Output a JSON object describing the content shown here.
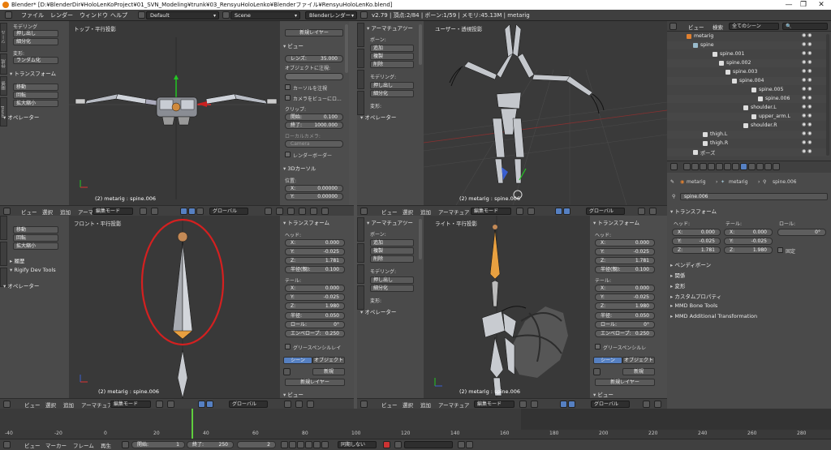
{
  "titlebar": {
    "text": "Blender* [D:¥BlenderDir¥HoloLenKoProject¥01_SVN_Modeling¥trunk¥03_RensyuHoloLenko¥Blenderファイル¥RensyuHoloLenKo.blend]"
  },
  "infobar": {
    "menus": [
      "ファイル",
      "レンダー",
      "ウィンドウ",
      "ヘルプ"
    ],
    "layout": "Default",
    "scene": "Scene",
    "engine": "Blenderレンダー",
    "stats": "v2.79 | 頂点:2/84 | ボーン:1/59 | メモリ:45.13M | metarig"
  },
  "tl_shelf": {
    "modeling_head": "モデリング",
    "btn1": "押し出し",
    "btn2": "細分化",
    "deform_head": "変形:",
    "deform_btn": "ランダム化",
    "transform_head": "トランスフォーム",
    "t1": "移動",
    "t2": "回転",
    "t3": "拡大縮小",
    "operator_head": "オペレーター",
    "tabs": [
      "ツール",
      "作成",
      "関係",
      "mmd"
    ]
  },
  "tl_view": {
    "title": "トップ・平行投影",
    "status": "(2) metarig : spine.006"
  },
  "tl_props": {
    "new_layer": "新規レイヤー",
    "view_head": "ビュー",
    "lens_label": "レンズ:",
    "lens_value": "35.000",
    "lock_label": "オブジェクトに注視:",
    "cursor_lock": "カーソルを注視",
    "cam_lock": "カメラをビューにロ...",
    "clip_label": "クリップ:",
    "clip_start_k": "開始:",
    "clip_start_v": "0.100",
    "clip_end_k": "終了:",
    "clip_end_v": "1000.000",
    "local_cam": "ローカルカメラ:",
    "camera": "Camera",
    "render_border": "レンダーボーダー",
    "cursor_head": "3Dカーソル",
    "loc_label": "位置:",
    "x_k": "X:",
    "x_v": "0.00000",
    "y_k": "Y:",
    "y_v": "0.00000"
  },
  "tr_shelf": {
    "armature_head": "アーマチュアツー",
    "bone_label": "ボーン:",
    "add": "追加",
    "dup": "複製",
    "del": "削除",
    "modeling": "モデリング:",
    "extrude": "押し出し",
    "subdiv": "細分化",
    "deform": "変形:",
    "operator_head": "オペレーター"
  },
  "tr_view": {
    "title": "ユーザー・透視投影",
    "status": "(2) metarig : spine.006"
  },
  "header_common": {
    "view": "ビュー",
    "select": "選択",
    "add": "追加",
    "armature": "アーマチュア",
    "mode": "編集モード",
    "orient": "グローバル"
  },
  "bl_shelf": {
    "t1": "移動",
    "t2": "回転",
    "t3": "拡大縮小",
    "history": "履歴",
    "rigify": "Rigify Dev Tools",
    "operator_head": "オペレーター"
  },
  "bl_view": {
    "title": "フロント・平行投影",
    "status": "(2) metarig : spine.006"
  },
  "bl_props": {
    "transform_head": "トランスフォーム",
    "head_label": "ヘッド:",
    "hx_k": "X:",
    "hx_v": "0.000",
    "hy_k": "Y:",
    "hy_v": "-0.025",
    "hz_k": "Z:",
    "hz_v": "1.781",
    "hr_k": "半径(親):",
    "hr_v": "0.100",
    "tail_label": "テール:",
    "tx_k": "X:",
    "tx_v": "0.000",
    "ty_k": "Y:",
    "ty_v": "-0.025",
    "tz_k": "Z:",
    "tz_v": "1.980",
    "rad_k": "半径:",
    "rad_v": "0.050",
    "roll_k": "ロール:",
    "roll_v": "0°",
    "env_k": "エンベロープ:",
    "env_v": "0.250",
    "gp_head": "グリースペンシルレイ",
    "scene": "シーン",
    "object": "オブジェクト",
    "new": "新規",
    "new_layer": "新規レイヤー",
    "view_head": "ビュー"
  },
  "br_shelf": {
    "armature_head": "アーマチュアツー",
    "bone_label": "ボーン:",
    "add": "追加",
    "dup": "複製",
    "del": "削除",
    "modeling": "モデリング:",
    "extrude": "押し出し",
    "subdiv": "細分化",
    "deform": "変形:",
    "operator_head": "オペレーター"
  },
  "br_view": {
    "title": "ライト・平行投影",
    "status": "(2) metarig : spine.006"
  },
  "br_props": {
    "transform_head": "トランスフォーム",
    "head_label": "ヘッド:",
    "hx_k": "X:",
    "hx_v": "0.000",
    "hy_k": "Y:",
    "hy_v": "-0.025",
    "hz_k": "Z:",
    "hz_v": "1.781",
    "hr_k": "半径(親):",
    "hr_v": "0.100",
    "tail_label": "テール:",
    "tx_k": "X:",
    "tx_v": "0.000",
    "ty_k": "Y:",
    "ty_v": "-0.025",
    "tz_k": "Z:",
    "tz_v": "1.980",
    "rad_k": "半径:",
    "rad_v": "0.050",
    "roll_k": "ロール:",
    "roll_v": "0°",
    "env_k": "エンベロープ:",
    "env_v": "0.250",
    "gp_head": "グリースペンシルレ",
    "scene": "シーン",
    "object": "オブジェクト",
    "new": "新規",
    "new_layer": "新規レイヤー",
    "view_head": "ビュー"
  },
  "outliner": {
    "view": "ビュー",
    "search": "検索",
    "filter": "全てのシーン",
    "rows": [
      "metarig",
      "spine",
      "spine.001",
      "spine.002",
      "spine.003",
      "spine.004",
      "spine.005",
      "spine.006",
      "shoulder.L",
      "upper_arm.L",
      "shoulder.R",
      "thigh.L",
      "thigh.R",
      "ポーズ"
    ]
  },
  "properties": {
    "crumb1": "metarig",
    "crumb2": "metarig",
    "crumb3": "spine.006",
    "bone_name": "spine.006",
    "transform_head": "トランスフォーム",
    "head_label": "ヘッド:",
    "tail_label": "テール:",
    "roll_label": "ロール:",
    "hx_k": "X:",
    "hx_v": "0.000",
    "hy_k": "Y:",
    "hy_v": "-0.025",
    "hz_k": "Z:",
    "hz_v": "1.781",
    "tx_k": "X:",
    "tx_v": "0.000",
    "ty_k": "Y:",
    "ty_v": "-0.025",
    "tz_k": "Z:",
    "tz_v": "1.980",
    "roll_v": "0°",
    "lock": "固定",
    "sections": [
      "ベンディボーン",
      "関係",
      "変形",
      "カスタムプロパティ",
      "MMD Bone Tools",
      "MMD Additional Transformation"
    ]
  },
  "timeline": {
    "ticks": [
      "-40",
      "-20",
      "0",
      "20",
      "40",
      "60",
      "80",
      "100",
      "120",
      "140",
      "160",
      "180",
      "200",
      "220",
      "240",
      "260",
      "280"
    ],
    "view": "ビュー",
    "marker": "マーカー",
    "frame": "フレーム",
    "play": "再生",
    "start_k": "開始:",
    "start_v": "1",
    "end_k": "終了:",
    "end_v": "250",
    "current": "2",
    "sync": "同期しない"
  }
}
